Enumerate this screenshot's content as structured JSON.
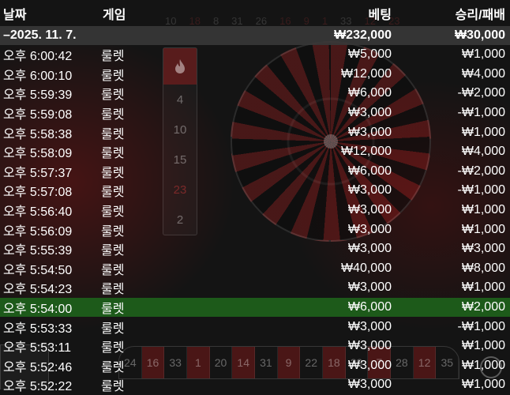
{
  "background": {
    "strip_numbers": [
      "10",
      "18",
      "8",
      "31",
      "26",
      "16",
      "9",
      "1",
      "33",
      "12",
      "23"
    ],
    "history_column": [
      "4",
      "10",
      "15",
      "23",
      "2"
    ],
    "table_numbers": [
      "24",
      "16",
      "33",
      "1",
      "20",
      "14",
      "31",
      "9",
      "22",
      "18",
      "29",
      "7",
      "28",
      "12",
      "35"
    ],
    "colors": {
      "accent_red": "#b02020",
      "highlight_green": "#1d5a1a",
      "summary_gray": "#373737"
    }
  },
  "columns": {
    "date": "날짜",
    "game": "게임",
    "bet": "베팅",
    "win_loss": "승리/패배"
  },
  "summary": {
    "date": "–2025. 11. 7.",
    "bet": "₩232,000",
    "win_loss": "₩30,000"
  },
  "rows": [
    {
      "time": "오후 6:00:42",
      "game": "룰렛",
      "bet": "₩5,000",
      "result": "₩1,000",
      "highlight": false
    },
    {
      "time": "오후 6:00:10",
      "game": "룰렛",
      "bet": "₩12,000",
      "result": "₩4,000",
      "highlight": false
    },
    {
      "time": "오후 5:59:39",
      "game": "룰렛",
      "bet": "₩6,000",
      "result": "-₩2,000",
      "highlight": false
    },
    {
      "time": "오후 5:59:08",
      "game": "룰렛",
      "bet": "₩3,000",
      "result": "-₩1,000",
      "highlight": false
    },
    {
      "time": "오후 5:58:38",
      "game": "룰렛",
      "bet": "₩3,000",
      "result": "₩1,000",
      "highlight": false
    },
    {
      "time": "오후 5:58:09",
      "game": "룰렛",
      "bet": "₩12,000",
      "result": "₩4,000",
      "highlight": false
    },
    {
      "time": "오후 5:57:37",
      "game": "룰렛",
      "bet": "₩6,000",
      "result": "-₩2,000",
      "highlight": false
    },
    {
      "time": "오후 5:57:08",
      "game": "룰렛",
      "bet": "₩3,000",
      "result": "-₩1,000",
      "highlight": false
    },
    {
      "time": "오후 5:56:40",
      "game": "룰렛",
      "bet": "₩3,000",
      "result": "₩1,000",
      "highlight": false
    },
    {
      "time": "오후 5:56:09",
      "game": "룰렛",
      "bet": "₩3,000",
      "result": "₩1,000",
      "highlight": false
    },
    {
      "time": "오후 5:55:39",
      "game": "룰렛",
      "bet": "₩3,000",
      "result": "₩3,000",
      "highlight": false
    },
    {
      "time": "오후 5:54:50",
      "game": "룰렛",
      "bet": "₩40,000",
      "result": "₩8,000",
      "highlight": false
    },
    {
      "time": "오후 5:54:23",
      "game": "룰렛",
      "bet": "₩3,000",
      "result": "₩1,000",
      "highlight": false
    },
    {
      "time": "오후 5:54:00",
      "game": "룰렛",
      "bet": "₩6,000",
      "result": "₩2,000",
      "highlight": true
    },
    {
      "time": "오후 5:53:33",
      "game": "룰렛",
      "bet": "₩3,000",
      "result": "-₩1,000",
      "highlight": false
    },
    {
      "time": "오후 5:53:11",
      "game": "룰렛",
      "bet": "₩3,000",
      "result": "₩1,000",
      "highlight": false
    },
    {
      "time": "오후 5:52:46",
      "game": "룰렛",
      "bet": "₩3,000",
      "result": "₩1,000",
      "highlight": false
    },
    {
      "time": "오후 5:52:22",
      "game": "룰렛",
      "bet": "₩3,000",
      "result": "₩1,000",
      "highlight": false
    }
  ]
}
